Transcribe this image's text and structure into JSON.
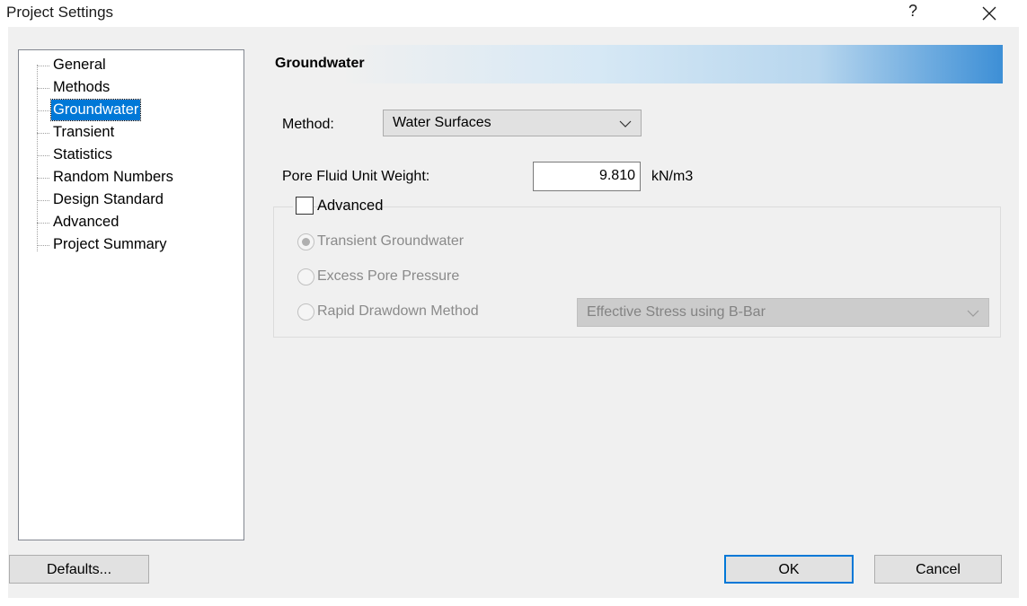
{
  "window": {
    "title": "Project Settings",
    "help_label": "?",
    "close_icon": "close-icon"
  },
  "tree": {
    "items": [
      {
        "label": "General",
        "selected": false
      },
      {
        "label": "Methods",
        "selected": false
      },
      {
        "label": "Groundwater",
        "selected": true
      },
      {
        "label": "Transient",
        "selected": false
      },
      {
        "label": "Statistics",
        "selected": false
      },
      {
        "label": "Random Numbers",
        "selected": false
      },
      {
        "label": "Design Standard",
        "selected": false
      },
      {
        "label": "Advanced",
        "selected": false
      },
      {
        "label": "Project Summary",
        "selected": false
      }
    ]
  },
  "panel": {
    "header": "Groundwater",
    "method_label": "Method:",
    "method_value": "Water Surfaces",
    "unit_weight_label": "Pore Fluid Unit Weight:",
    "unit_weight_value": "9.810",
    "unit_weight_unit": "kN/m3",
    "advanced": {
      "label": "Advanced",
      "checked": false,
      "options": [
        {
          "label": "Transient Groundwater",
          "checked": true
        },
        {
          "label": "Excess Pore Pressure",
          "checked": false
        },
        {
          "label": "Rapid Drawdown Method",
          "checked": false
        }
      ],
      "rapid_drawdown_value": "Effective Stress using B-Bar"
    }
  },
  "buttons": {
    "defaults": "Defaults...",
    "ok": "OK",
    "cancel": "Cancel"
  },
  "colors": {
    "selection": "#0078d7",
    "header_gradient_end": "#3d8fd6",
    "dialog_bg": "#f0f0f0"
  }
}
